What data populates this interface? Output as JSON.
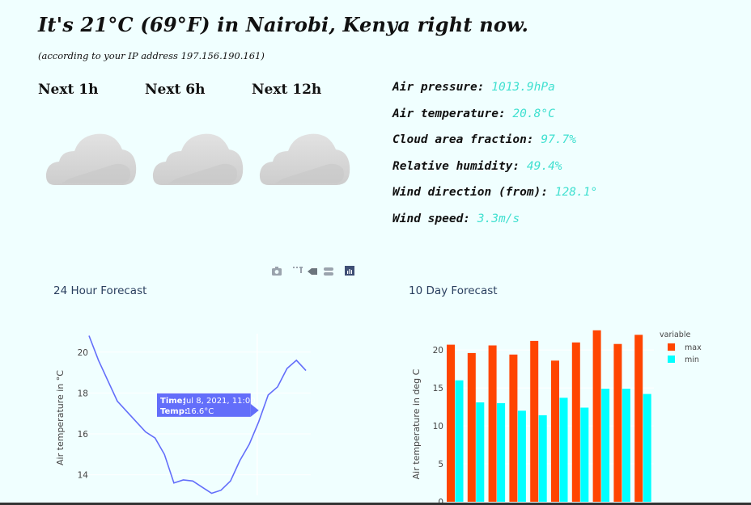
{
  "header": {
    "title": "It's 21°C (69°F) in Nairobi, Kenya right now.",
    "subtitle": "(according to your IP address 197.156.190.161)"
  },
  "outlook": [
    {
      "label": "Next 1h",
      "icon": "cloud-icon"
    },
    {
      "label": "Next 6h",
      "icon": "cloud-icon"
    },
    {
      "label": "Next 12h",
      "icon": "cloud-icon"
    }
  ],
  "stats": [
    {
      "label": "Air pressure:",
      "value": "1013.9hPa"
    },
    {
      "label": "Air temperature:",
      "value": "20.8°C"
    },
    {
      "label": "Cloud area fraction:",
      "value": "97.7%"
    },
    {
      "label": "Relative humidity:",
      "value": "49.4%"
    },
    {
      "label": "Wind direction (from):",
      "value": "128.1°"
    },
    {
      "label": "Wind speed:",
      "value": "3.3m/s"
    }
  ],
  "modebar": [
    "camera-icon",
    "zoom-icon",
    "pan-icon",
    "compare-icon",
    "plotly-logo-icon"
  ],
  "colors": {
    "background": "#f0ffff",
    "stat_value": "#40e0d0",
    "line": "#636efa",
    "max": "#ff4500",
    "min": "#00ffff",
    "tooltip": "#636efa"
  },
  "chart_data": [
    {
      "type": "line",
      "title": "24 Hour Forecast",
      "xlabel": "",
      "ylabel": "Air temperature in °C",
      "yticks": [
        "14",
        "16",
        "18",
        "20"
      ],
      "ylim": [
        13.0,
        20.9
      ],
      "series": [
        {
          "values": [
            20.8,
            19.6,
            18.6,
            17.6,
            17.1,
            16.6,
            16.1,
            15.8,
            15.0,
            13.6,
            13.75,
            13.7,
            13.4,
            13.1,
            13.25,
            13.7,
            14.7,
            15.5,
            16.6,
            17.9,
            18.3,
            19.2,
            19.6,
            19.1
          ]
        }
      ],
      "tooltip": {
        "time_label": "Time:",
        "time_value": "Jul 8, 2021, 11:00",
        "temp_label": "Temp:",
        "temp_value": "16.6°C",
        "index": 18
      }
    },
    {
      "type": "bar",
      "title": "10 Day Forecast",
      "xlabel": "",
      "ylabel": "Air temperature in deg C",
      "yticks": [
        "0",
        "5",
        "10",
        "15",
        "20"
      ],
      "ylim": [
        0,
        23
      ],
      "legend_title": "variable",
      "legend_placement": "top-right",
      "series": [
        {
          "name": "max",
          "values": [
            20.7,
            19.6,
            20.6,
            19.4,
            21.2,
            18.6,
            21.0,
            22.6,
            20.8,
            22.0
          ]
        },
        {
          "name": "min",
          "values": [
            16.0,
            13.1,
            13.0,
            12.0,
            11.4,
            13.7,
            12.4,
            14.9,
            14.9,
            14.2
          ]
        }
      ]
    }
  ]
}
